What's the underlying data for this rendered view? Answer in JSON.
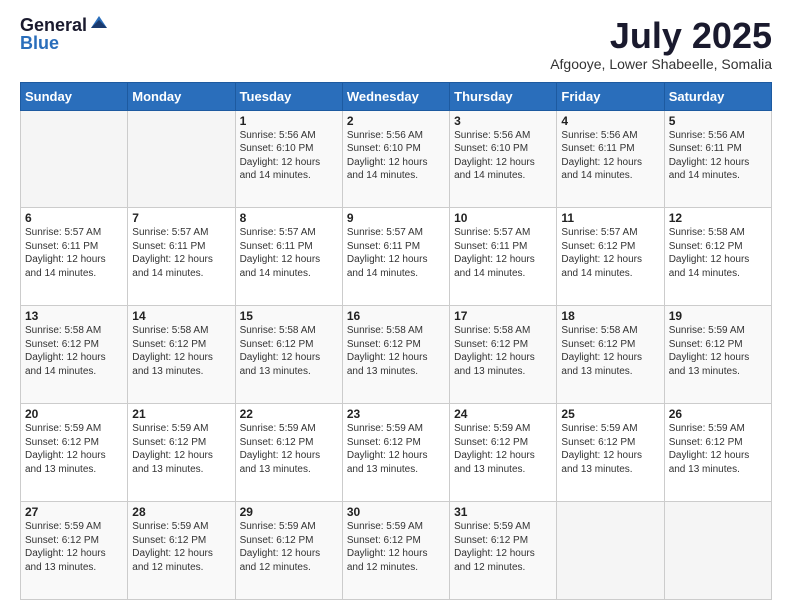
{
  "logo": {
    "general": "General",
    "blue": "Blue"
  },
  "title": "July 2025",
  "location": "Afgooye, Lower Shabeelle, Somalia",
  "days_of_week": [
    "Sunday",
    "Monday",
    "Tuesday",
    "Wednesday",
    "Thursday",
    "Friday",
    "Saturday"
  ],
  "weeks": [
    [
      {
        "day": "",
        "sunrise": "",
        "sunset": "",
        "daylight": ""
      },
      {
        "day": "",
        "sunrise": "",
        "sunset": "",
        "daylight": ""
      },
      {
        "day": "1",
        "sunrise": "Sunrise: 5:56 AM",
        "sunset": "Sunset: 6:10 PM",
        "daylight": "Daylight: 12 hours and 14 minutes."
      },
      {
        "day": "2",
        "sunrise": "Sunrise: 5:56 AM",
        "sunset": "Sunset: 6:10 PM",
        "daylight": "Daylight: 12 hours and 14 minutes."
      },
      {
        "day": "3",
        "sunrise": "Sunrise: 5:56 AM",
        "sunset": "Sunset: 6:10 PM",
        "daylight": "Daylight: 12 hours and 14 minutes."
      },
      {
        "day": "4",
        "sunrise": "Sunrise: 5:56 AM",
        "sunset": "Sunset: 6:11 PM",
        "daylight": "Daylight: 12 hours and 14 minutes."
      },
      {
        "day": "5",
        "sunrise": "Sunrise: 5:56 AM",
        "sunset": "Sunset: 6:11 PM",
        "daylight": "Daylight: 12 hours and 14 minutes."
      }
    ],
    [
      {
        "day": "6",
        "sunrise": "Sunrise: 5:57 AM",
        "sunset": "Sunset: 6:11 PM",
        "daylight": "Daylight: 12 hours and 14 minutes."
      },
      {
        "day": "7",
        "sunrise": "Sunrise: 5:57 AM",
        "sunset": "Sunset: 6:11 PM",
        "daylight": "Daylight: 12 hours and 14 minutes."
      },
      {
        "day": "8",
        "sunrise": "Sunrise: 5:57 AM",
        "sunset": "Sunset: 6:11 PM",
        "daylight": "Daylight: 12 hours and 14 minutes."
      },
      {
        "day": "9",
        "sunrise": "Sunrise: 5:57 AM",
        "sunset": "Sunset: 6:11 PM",
        "daylight": "Daylight: 12 hours and 14 minutes."
      },
      {
        "day": "10",
        "sunrise": "Sunrise: 5:57 AM",
        "sunset": "Sunset: 6:11 PM",
        "daylight": "Daylight: 12 hours and 14 minutes."
      },
      {
        "day": "11",
        "sunrise": "Sunrise: 5:57 AM",
        "sunset": "Sunset: 6:12 PM",
        "daylight": "Daylight: 12 hours and 14 minutes."
      },
      {
        "day": "12",
        "sunrise": "Sunrise: 5:58 AM",
        "sunset": "Sunset: 6:12 PM",
        "daylight": "Daylight: 12 hours and 14 minutes."
      }
    ],
    [
      {
        "day": "13",
        "sunrise": "Sunrise: 5:58 AM",
        "sunset": "Sunset: 6:12 PM",
        "daylight": "Daylight: 12 hours and 14 minutes."
      },
      {
        "day": "14",
        "sunrise": "Sunrise: 5:58 AM",
        "sunset": "Sunset: 6:12 PM",
        "daylight": "Daylight: 12 hours and 13 minutes."
      },
      {
        "day": "15",
        "sunrise": "Sunrise: 5:58 AM",
        "sunset": "Sunset: 6:12 PM",
        "daylight": "Daylight: 12 hours and 13 minutes."
      },
      {
        "day": "16",
        "sunrise": "Sunrise: 5:58 AM",
        "sunset": "Sunset: 6:12 PM",
        "daylight": "Daylight: 12 hours and 13 minutes."
      },
      {
        "day": "17",
        "sunrise": "Sunrise: 5:58 AM",
        "sunset": "Sunset: 6:12 PM",
        "daylight": "Daylight: 12 hours and 13 minutes."
      },
      {
        "day": "18",
        "sunrise": "Sunrise: 5:58 AM",
        "sunset": "Sunset: 6:12 PM",
        "daylight": "Daylight: 12 hours and 13 minutes."
      },
      {
        "day": "19",
        "sunrise": "Sunrise: 5:59 AM",
        "sunset": "Sunset: 6:12 PM",
        "daylight": "Daylight: 12 hours and 13 minutes."
      }
    ],
    [
      {
        "day": "20",
        "sunrise": "Sunrise: 5:59 AM",
        "sunset": "Sunset: 6:12 PM",
        "daylight": "Daylight: 12 hours and 13 minutes."
      },
      {
        "day": "21",
        "sunrise": "Sunrise: 5:59 AM",
        "sunset": "Sunset: 6:12 PM",
        "daylight": "Daylight: 12 hours and 13 minutes."
      },
      {
        "day": "22",
        "sunrise": "Sunrise: 5:59 AM",
        "sunset": "Sunset: 6:12 PM",
        "daylight": "Daylight: 12 hours and 13 minutes."
      },
      {
        "day": "23",
        "sunrise": "Sunrise: 5:59 AM",
        "sunset": "Sunset: 6:12 PM",
        "daylight": "Daylight: 12 hours and 13 minutes."
      },
      {
        "day": "24",
        "sunrise": "Sunrise: 5:59 AM",
        "sunset": "Sunset: 6:12 PM",
        "daylight": "Daylight: 12 hours and 13 minutes."
      },
      {
        "day": "25",
        "sunrise": "Sunrise: 5:59 AM",
        "sunset": "Sunset: 6:12 PM",
        "daylight": "Daylight: 12 hours and 13 minutes."
      },
      {
        "day": "26",
        "sunrise": "Sunrise: 5:59 AM",
        "sunset": "Sunset: 6:12 PM",
        "daylight": "Daylight: 12 hours and 13 minutes."
      }
    ],
    [
      {
        "day": "27",
        "sunrise": "Sunrise: 5:59 AM",
        "sunset": "Sunset: 6:12 PM",
        "daylight": "Daylight: 12 hours and 13 minutes."
      },
      {
        "day": "28",
        "sunrise": "Sunrise: 5:59 AM",
        "sunset": "Sunset: 6:12 PM",
        "daylight": "Daylight: 12 hours and 12 minutes."
      },
      {
        "day": "29",
        "sunrise": "Sunrise: 5:59 AM",
        "sunset": "Sunset: 6:12 PM",
        "daylight": "Daylight: 12 hours and 12 minutes."
      },
      {
        "day": "30",
        "sunrise": "Sunrise: 5:59 AM",
        "sunset": "Sunset: 6:12 PM",
        "daylight": "Daylight: 12 hours and 12 minutes."
      },
      {
        "day": "31",
        "sunrise": "Sunrise: 5:59 AM",
        "sunset": "Sunset: 6:12 PM",
        "daylight": "Daylight: 12 hours and 12 minutes."
      },
      {
        "day": "",
        "sunrise": "",
        "sunset": "",
        "daylight": ""
      },
      {
        "day": "",
        "sunrise": "",
        "sunset": "",
        "daylight": ""
      }
    ]
  ]
}
